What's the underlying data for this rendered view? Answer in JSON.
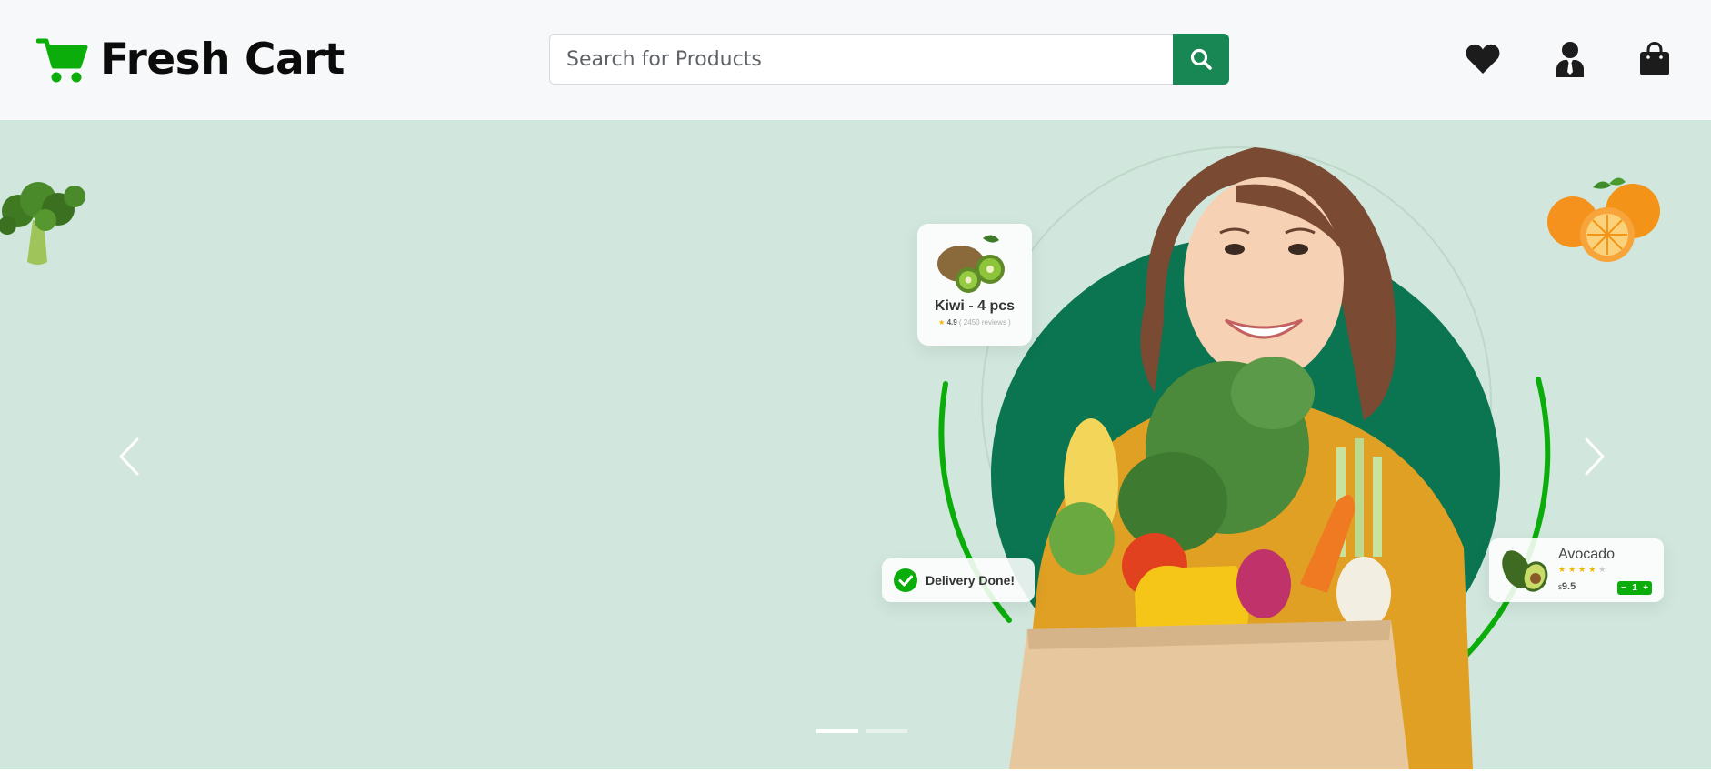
{
  "header": {
    "brand_name": "Fresh Cart",
    "brand_icon": "shopping-cart-icon",
    "brand_color": "#0aad0a",
    "search": {
      "placeholder": "Search for Products",
      "value": "",
      "button_icon": "search-icon",
      "button_color": "#198754"
    },
    "icons": [
      "heart-icon",
      "user-icon",
      "shopping-bag-icon"
    ]
  },
  "hero": {
    "background": "#d1e7dd",
    "accent_dark": "#0b7450",
    "accent_ring": "#0aad0a",
    "kiwi_card": {
      "title": "Kiwi - 4 pcs",
      "rating": "4.9",
      "reviews": "( 2450 reviews )"
    },
    "delivery_card": {
      "text": "Delivery Done!"
    },
    "avocado_card": {
      "name": "Avocado",
      "price_currency": "$",
      "price": "9.5",
      "rating": 4,
      "rating_max": 5,
      "qty": "1",
      "minus": "−",
      "plus": "+"
    },
    "carousel": {
      "slides": 2,
      "active_index": 0
    }
  }
}
